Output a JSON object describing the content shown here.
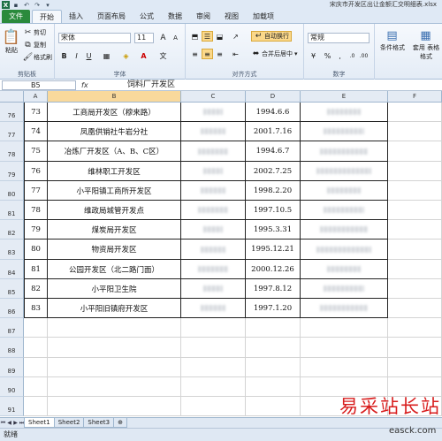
{
  "app": {
    "title": "宋庆市开发区出让金额汇交明细表.xlsx",
    "accent_file_tab": "#2a8a3c",
    "selection_color": "#f9d99c",
    "watermark_color": "#d81e1e"
  },
  "quick_access": {
    "save_icon": "save-icon",
    "undo_icon": "undo-icon",
    "redo_icon": "redo-icon"
  },
  "tabs": [
    "文件",
    "开始",
    "插入",
    "页面布局",
    "公式",
    "数据",
    "审阅",
    "视图",
    "加载项"
  ],
  "active_tab": "开始",
  "ribbon": {
    "clipboard": {
      "label": "剪贴板",
      "paste": "粘贴",
      "cut": "剪切",
      "copy": "复制",
      "format_painter": "格式刷"
    },
    "font": {
      "label": "字体",
      "font_name": "宋体",
      "font_size": "11",
      "bold": "B",
      "italic": "I",
      "underline": "U",
      "grow": "A",
      "shrink": "A",
      "phonetic": "文"
    },
    "alignment": {
      "label": "对齐方式",
      "wrap_text": "自动换行",
      "merge_center": "合并后居中"
    },
    "number": {
      "label": "数字",
      "format": "常规",
      "percent": "%",
      "comma": ",",
      "currency": "¥"
    },
    "styles": {
      "conditional": "条件格式",
      "table_format": "套用 表格格式"
    }
  },
  "formula_bar": {
    "name_box": "B5",
    "fx": "fx",
    "content": "饲料厂开发区"
  },
  "columns": [
    "A",
    "B",
    "C",
    "D",
    "E",
    "F"
  ],
  "rows": [
    {
      "num": "76",
      "a": "73",
      "b": "工商局开发区（穆来路）",
      "d": "1994.6.6"
    },
    {
      "num": "77",
      "a": "74",
      "b": "凤凰供销社牛岩分社",
      "d": "2001.7.16"
    },
    {
      "num": "78",
      "a": "75",
      "b": "冶炼厂开发区（A、B、C区）",
      "d": "1994.6.7"
    },
    {
      "num": "79",
      "a": "76",
      "b": "维林职工开发区",
      "d": "2002.7.25"
    },
    {
      "num": "80",
      "a": "77",
      "b": "小平阳镇工商所开发区",
      "d": "1998.2.20"
    },
    {
      "num": "81",
      "a": "78",
      "b": "维政局城管开发点",
      "d": "1997.10.5"
    },
    {
      "num": "82",
      "a": "79",
      "b": "煤炭局开发区",
      "d": "1995.3.31"
    },
    {
      "num": "83",
      "a": "80",
      "b": "物资局开发区",
      "d": "1995.12.21"
    },
    {
      "num": "84",
      "a": "81",
      "b": "公园开发区（北二路门面）",
      "d": "2000.12.26"
    },
    {
      "num": "85",
      "a": "82",
      "b": "小平阳卫生院",
      "d": "1997.8.12"
    },
    {
      "num": "86",
      "a": "83",
      "b": "小平阳旧镇府开发区",
      "d": "1997.1.20"
    },
    {
      "num": "87",
      "a": "",
      "b": "",
      "d": ""
    },
    {
      "num": "88",
      "a": "",
      "b": "",
      "d": ""
    },
    {
      "num": "89",
      "a": "",
      "b": "",
      "d": ""
    },
    {
      "num": "90",
      "a": "",
      "b": "",
      "d": ""
    },
    {
      "num": "91",
      "a": "",
      "b": "",
      "d": ""
    }
  ],
  "sheet_tabs": [
    "Sheet1",
    "Sheet2",
    "Sheet3"
  ],
  "active_sheet": "Sheet1",
  "status": "就绪",
  "watermark": {
    "main": "易采站长站",
    "url": "easck.com"
  }
}
